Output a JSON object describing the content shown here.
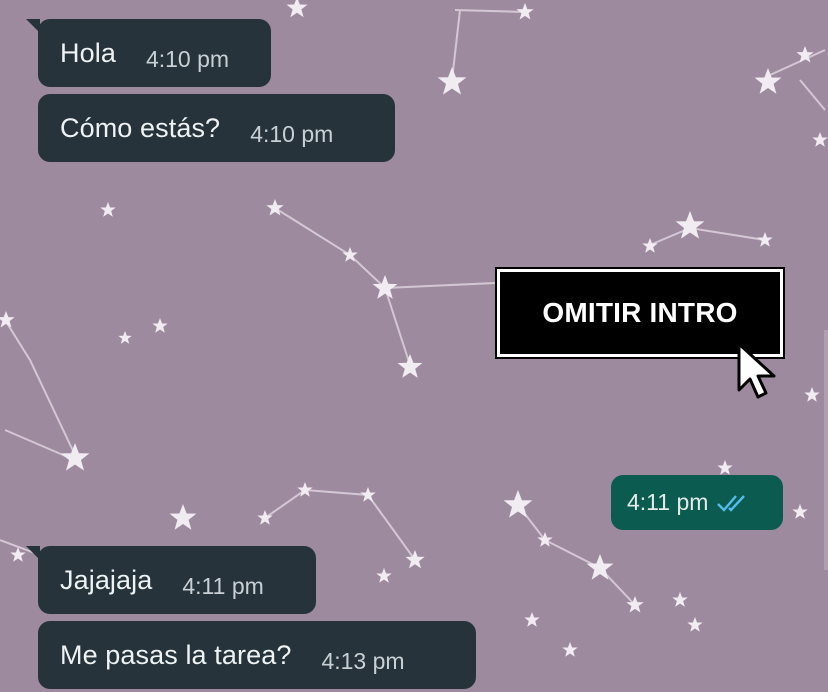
{
  "messages": [
    {
      "direction": "in",
      "text": "Hola",
      "time": "4:10 pm"
    },
    {
      "direction": "in",
      "text": "Cómo estás?",
      "time": "4:10 pm"
    },
    {
      "direction": "out",
      "text": "",
      "time": "4:11 pm",
      "status": "double-check-read"
    },
    {
      "direction": "in",
      "text": "Jajajaja",
      "time": "4:11 pm"
    },
    {
      "direction": "in",
      "text": "Me pasas la tarea?",
      "time": "4:13 pm"
    }
  ],
  "overlay": {
    "skip_label": "OMITIR INTRO",
    "cursor_icon": "arrow-cursor-icon"
  },
  "colors": {
    "wallpaper": "#9e8a9f",
    "incoming_bubble": "#26333b",
    "outgoing_bubble": "#0b5b51",
    "read_ticks": "#53bdeb",
    "button_background": "#000000",
    "button_text": "#ffffff"
  },
  "icons": {
    "wallpaper": "constellation-stars-pattern",
    "read_status": "double-check-icon"
  }
}
